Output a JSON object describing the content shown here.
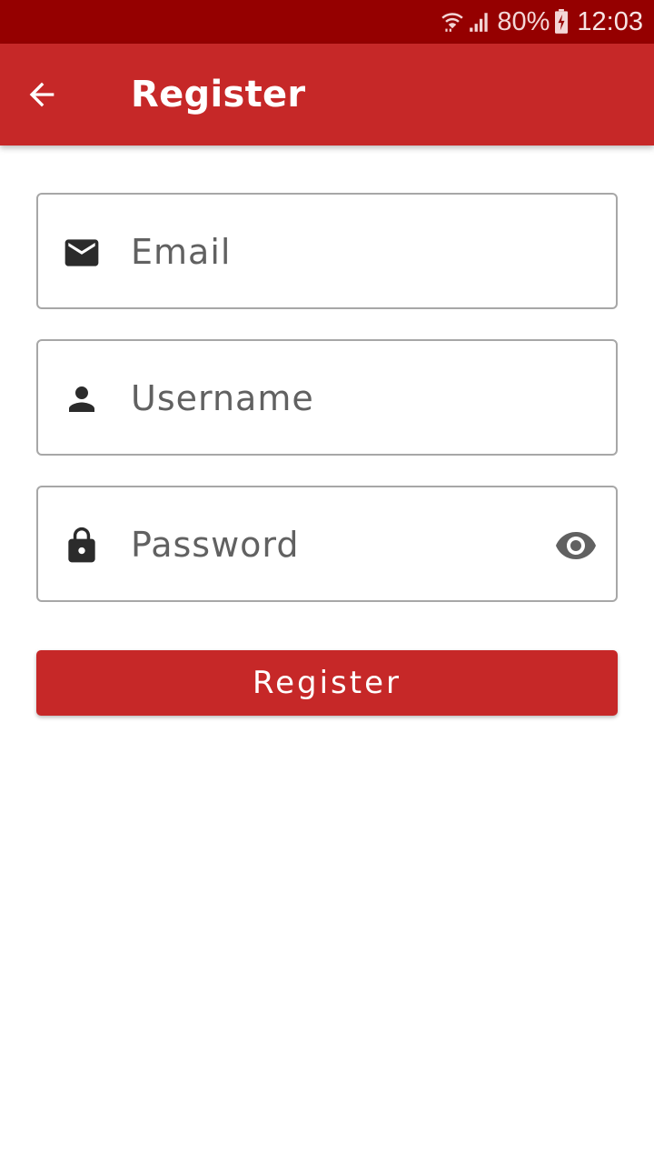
{
  "status_bar": {
    "battery_percent": "80%",
    "time": "12:03",
    "icons": [
      "wifi-icon",
      "signal-icon",
      "battery-charging-icon"
    ]
  },
  "app_bar": {
    "title": "Register",
    "back_icon": "arrow-left-icon"
  },
  "form": {
    "email": {
      "placeholder": "Email",
      "value": "",
      "icon": "email-icon"
    },
    "username": {
      "placeholder": "Username",
      "value": "",
      "icon": "person-icon"
    },
    "password": {
      "placeholder": "Password",
      "value": "",
      "icon": "lock-icon",
      "toggle_icon": "eye-icon"
    },
    "submit_label": "Register"
  },
  "colors": {
    "status_bar": "#950000",
    "primary": "#c62828",
    "field_border": "#a7a7a7",
    "placeholder": "#616161",
    "icon": "#2b2b2b"
  }
}
